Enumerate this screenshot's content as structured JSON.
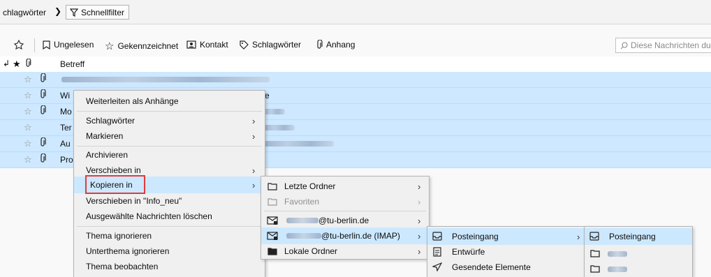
{
  "filterbar": {
    "tags_label": "chlagwörter",
    "quickfilter_label": "Schnellfilter"
  },
  "toolbar": {
    "unread": "Ungelesen",
    "starred": "Gekennzeichnet",
    "contact": "Kontakt",
    "tags": "Schlagwörter",
    "attachment": "Anhang",
    "search_placeholder": "Diese Nachrichten du"
  },
  "columns": {
    "subject": "Betreff"
  },
  "messages": [
    {
      "subject_prefix": "",
      "attach": true
    },
    {
      "subject_prefix": "Wi",
      "attach": true,
      "suffix": "e"
    },
    {
      "subject_prefix": "Mo",
      "attach": true
    },
    {
      "subject_prefix": "Ter",
      "attach": false
    },
    {
      "subject_prefix": "Au",
      "attach": true
    },
    {
      "subject_prefix": "Pro",
      "attach": true
    }
  ],
  "context_menu": {
    "forward": "Weiterleiten als Anhänge",
    "tags": "Schlagwörter",
    "mark": "Markieren",
    "archive": "Archivieren",
    "move": "Verschieben in",
    "copy": "Kopieren in",
    "move_info": "Verschieben in \"Info_neu\"",
    "delete": "Ausgewählte Nachrichten löschen",
    "ignore_thread": "Thema ignorieren",
    "ignore_subthread": "Unterthema ignorieren",
    "watch_thread": "Thema beobachten"
  },
  "copy_submenu": {
    "recent": "Letzte Ordner",
    "favorites": "Favoriten",
    "account1": "@tu-berlin.de",
    "account2": "@tu-berlin.de (IMAP)",
    "local": "Lokale Ordner"
  },
  "imap_submenu": {
    "inbox": "Posteingang",
    "drafts": "Entwürfe",
    "sent": "Gesendete Elemente"
  },
  "inbox_submenu": {
    "inbox": "Posteingang"
  }
}
